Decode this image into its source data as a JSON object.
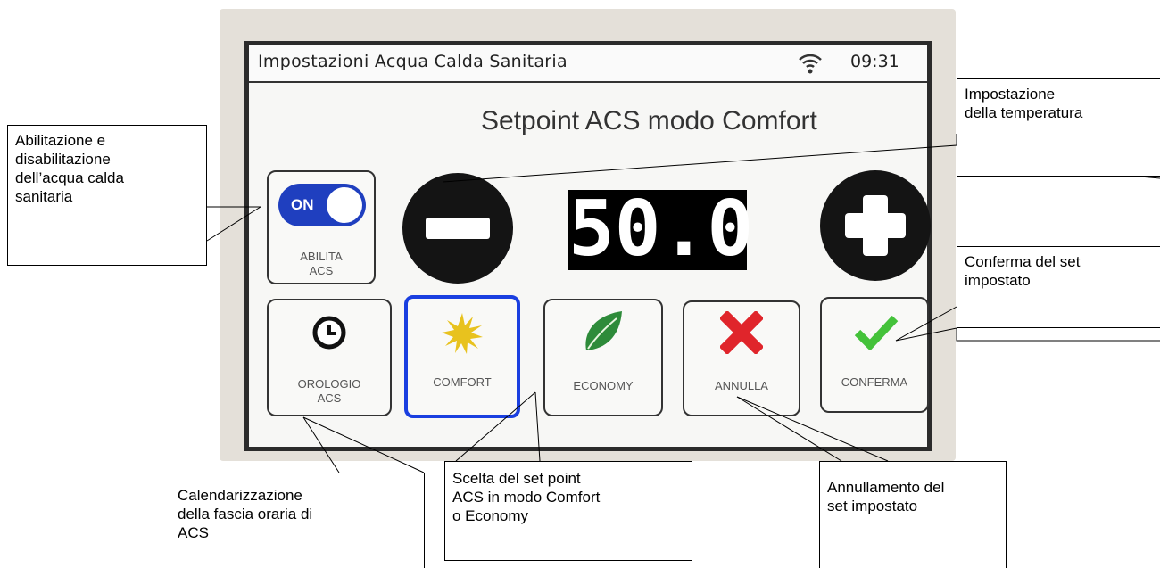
{
  "screen": {
    "title": "Impostazioni Acqua Calda Sanitaria",
    "time": "09:31",
    "setpoint_title": "Setpoint ACS modo Comfort",
    "temperature": "50.0",
    "toggle_label": "ON",
    "enable_button": [
      "ABILITA",
      "ACS"
    ],
    "clock_button": [
      "OROLOGIO",
      "ACS"
    ],
    "comfort_label": "COMFORT",
    "economy_label": "ECONOMY",
    "cancel_label": "ANNULLA",
    "confirm_label": "CONFERMA",
    "selected_mode": "COMFORT",
    "colors": {
      "toggle": "#1f3fbf",
      "selected_border": "#1a3fe0",
      "cancel": "#e0252b",
      "confirm": "#44c23a",
      "economy_leaf": "#2e8b3a",
      "comfort_sun": "#e8c21e"
    }
  },
  "callouts": {
    "enable": [
      "Abilitazione e",
      "disabilitazione",
      "dell’acqua calda",
      "sanitaria"
    ],
    "temperature": [
      "Impostazione",
      "della temperatura"
    ],
    "confirm": [
      "Conferma del set",
      "impostato"
    ],
    "schedule": [
      "Calendarizzazione",
      "della fascia oraria di",
      "ACS"
    ],
    "mode": [
      "Scelta del set point",
      "ACS in modo Comfort",
      "o Economy"
    ],
    "cancel": [
      "Annullamento del",
      "set impostato"
    ]
  }
}
